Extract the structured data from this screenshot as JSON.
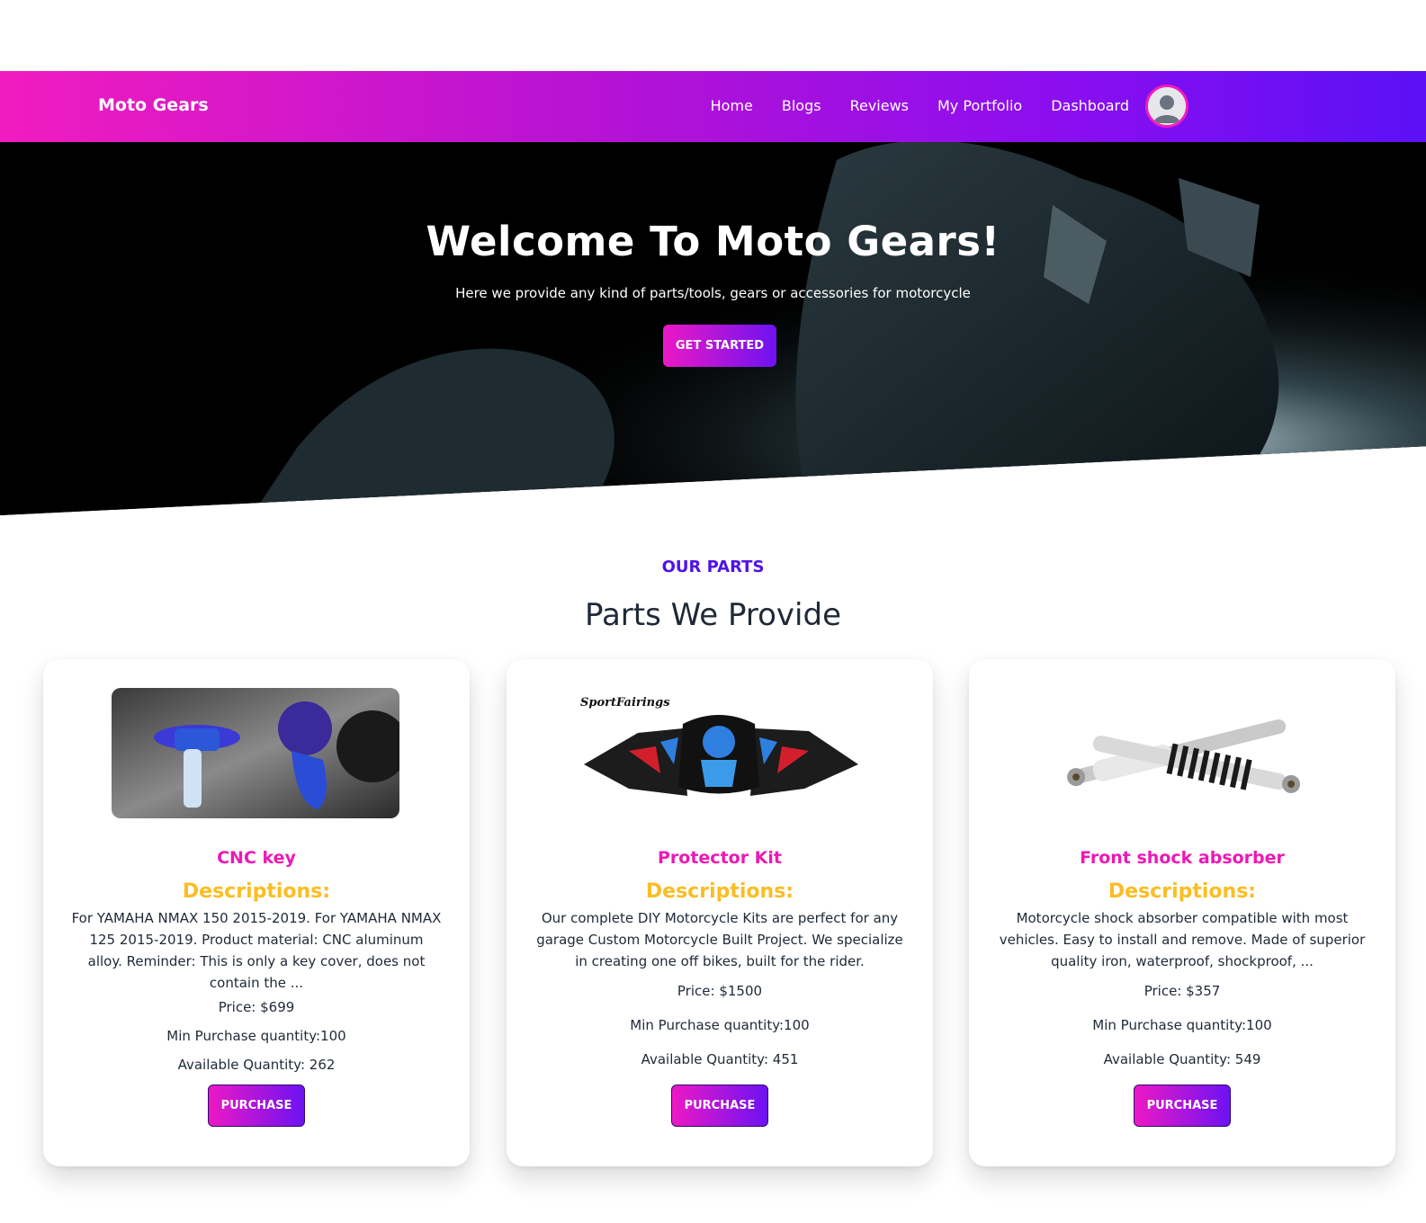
{
  "nav": {
    "brand": "Moto Gears",
    "links": [
      "Home",
      "Blogs",
      "Reviews",
      "My Portfolio",
      "Dashboard"
    ]
  },
  "hero": {
    "title": "Welcome To Moto Gears!",
    "subtitle": "Here we provide any kind of parts/tools, gears or accessories for motorcycle",
    "cta": "GET STARTED"
  },
  "section": {
    "eyebrow": "OUR PARTS",
    "title": "Parts We Provide"
  },
  "parts": [
    {
      "name": "CNC key",
      "desc_heading": "Descriptions:",
      "description": "For YAMAHA NMAX 150 2015-2019. For YAMAHA NMAX 125 2015-2019. Product material: CNC aluminum alloy. Reminder: This is only a key cover, does not contain the ...",
      "price": "Price: $699",
      "min_qty": "Min Purchase quantity:100",
      "available": "Available Quantity: 262",
      "button": "PURCHASE"
    },
    {
      "name": "Protector Kit",
      "desc_heading": "Descriptions:",
      "description": "Our complete DIY Motorcycle Kits are perfect for any garage Custom Motorcycle Built Project. We specialize in creating one off bikes, built for the rider.",
      "price": "Price: $1500",
      "min_qty": "Min Purchase quantity:100",
      "available": "Available Quantity: 451",
      "button": "PURCHASE",
      "image_text": "SportFairings"
    },
    {
      "name": "Front shock absorber",
      "desc_heading": "Descriptions:",
      "description": "Motorcycle shock absorber compatible with most vehicles. Easy to install and remove. Made of superior quality iron, waterproof, shockproof, ...",
      "price": "Price: $357",
      "min_qty": "Min Purchase quantity:100",
      "available": "Available Quantity: 549",
      "button": "PURCHASE"
    }
  ],
  "colors": {
    "nav_gradient_start": "#f11cbf",
    "nav_gradient_end": "#5b10f5",
    "eyebrow": "#4f12e8",
    "part_name": "#ec19b5",
    "desc_heading": "#fbbd23"
  }
}
